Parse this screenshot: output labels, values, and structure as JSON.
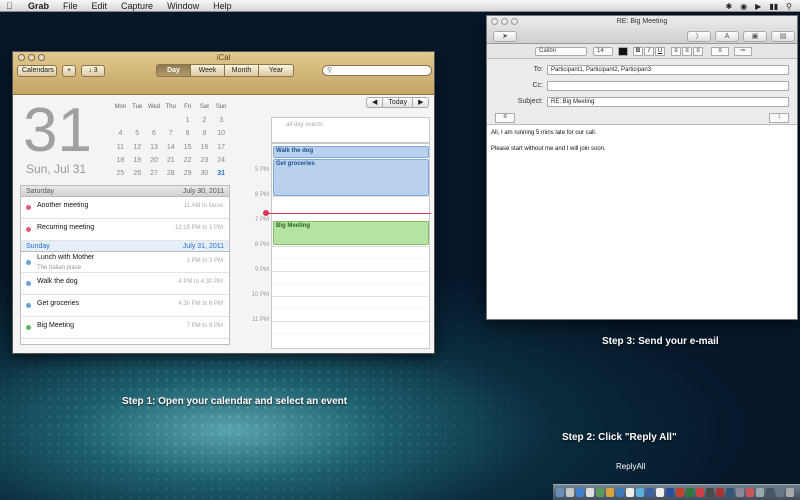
{
  "menubar": {
    "app": "Grab",
    "items": [
      "File",
      "Edit",
      "Capture",
      "Window",
      "Help"
    ]
  },
  "ical": {
    "title": "iCal",
    "toolbar": {
      "calendars": "Calendars",
      "add": "+",
      "inbox": "3",
      "views": [
        "Day",
        "Week",
        "Month",
        "Year"
      ],
      "active_view": "Day",
      "search_placeholder": ""
    },
    "big_date": "31",
    "date_sub": "Sun, Jul 31",
    "mini_cal": {
      "headers": [
        "Mon",
        "Tue",
        "Wed",
        "Thu",
        "Fri",
        "Sat",
        "Sun"
      ],
      "rows": [
        [
          "",
          "",
          "",
          "",
          "1",
          "2",
          "3"
        ],
        [
          "4",
          "5",
          "6",
          "7",
          "8",
          "9",
          "10"
        ],
        [
          "11",
          "12",
          "13",
          "14",
          "15",
          "16",
          "17"
        ],
        [
          "18",
          "19",
          "20",
          "21",
          "22",
          "23",
          "24"
        ],
        [
          "25",
          "26",
          "27",
          "28",
          "29",
          "30",
          "31"
        ]
      ]
    },
    "list": {
      "day1": {
        "name": "Saturday",
        "date": "July 30, 2011"
      },
      "day1_events": [
        {
          "title": "Another meeting",
          "time": "11 AM to Noon",
          "color": "#e05a7a"
        },
        {
          "title": "Recurring meeting",
          "time": "12:15 PM to 1 PM",
          "color": "#e05a7a"
        }
      ],
      "day2": {
        "name": "Sunday",
        "date": "July 31, 2011"
      },
      "day2_events": [
        {
          "title": "Lunch with Mother",
          "sub": "The Italian place",
          "time": "1 PM to 3 PM",
          "color": "#6a9fd8"
        },
        {
          "title": "Walk the dog",
          "time": "4 PM to 4:30 PM",
          "color": "#6a9fd8"
        },
        {
          "title": "Get groceries",
          "time": "4:30 PM to 6 PM",
          "color": "#6a9fd8"
        },
        {
          "title": "Big Meeting",
          "time": "7 PM to 8 PM",
          "color": "#5cb85c"
        }
      ]
    },
    "nav": {
      "prev": "◀",
      "today": "Today",
      "next": "▶"
    },
    "allday_label": "all-day events",
    "hours": [
      "5 PM",
      "6 PM",
      "7 PM",
      "8 PM",
      "9 PM",
      "10 PM",
      "11 PM"
    ],
    "day_events": [
      "Walk the dog",
      "Get groceries",
      "Big Meeting"
    ]
  },
  "mail": {
    "title": "RE: Big Meeting",
    "font": "Calibri",
    "size": "14",
    "to_label": "To:",
    "to": "Participant1, Participant2, Participan3",
    "cc_label": "Cc:",
    "cc": "",
    "subject_label": "Subject:",
    "subject": "RE: Big Meeting",
    "body": [
      "All, I am running 5 mins late for our call.",
      "Please start without me and I will join soon."
    ]
  },
  "captions": {
    "step1": "Step 1: Open your calendar and select an event",
    "step2": "Step 2: Click \"Reply All\"",
    "step3": "Step 3: Send your e-mail",
    "reply": "ReplyAll"
  }
}
